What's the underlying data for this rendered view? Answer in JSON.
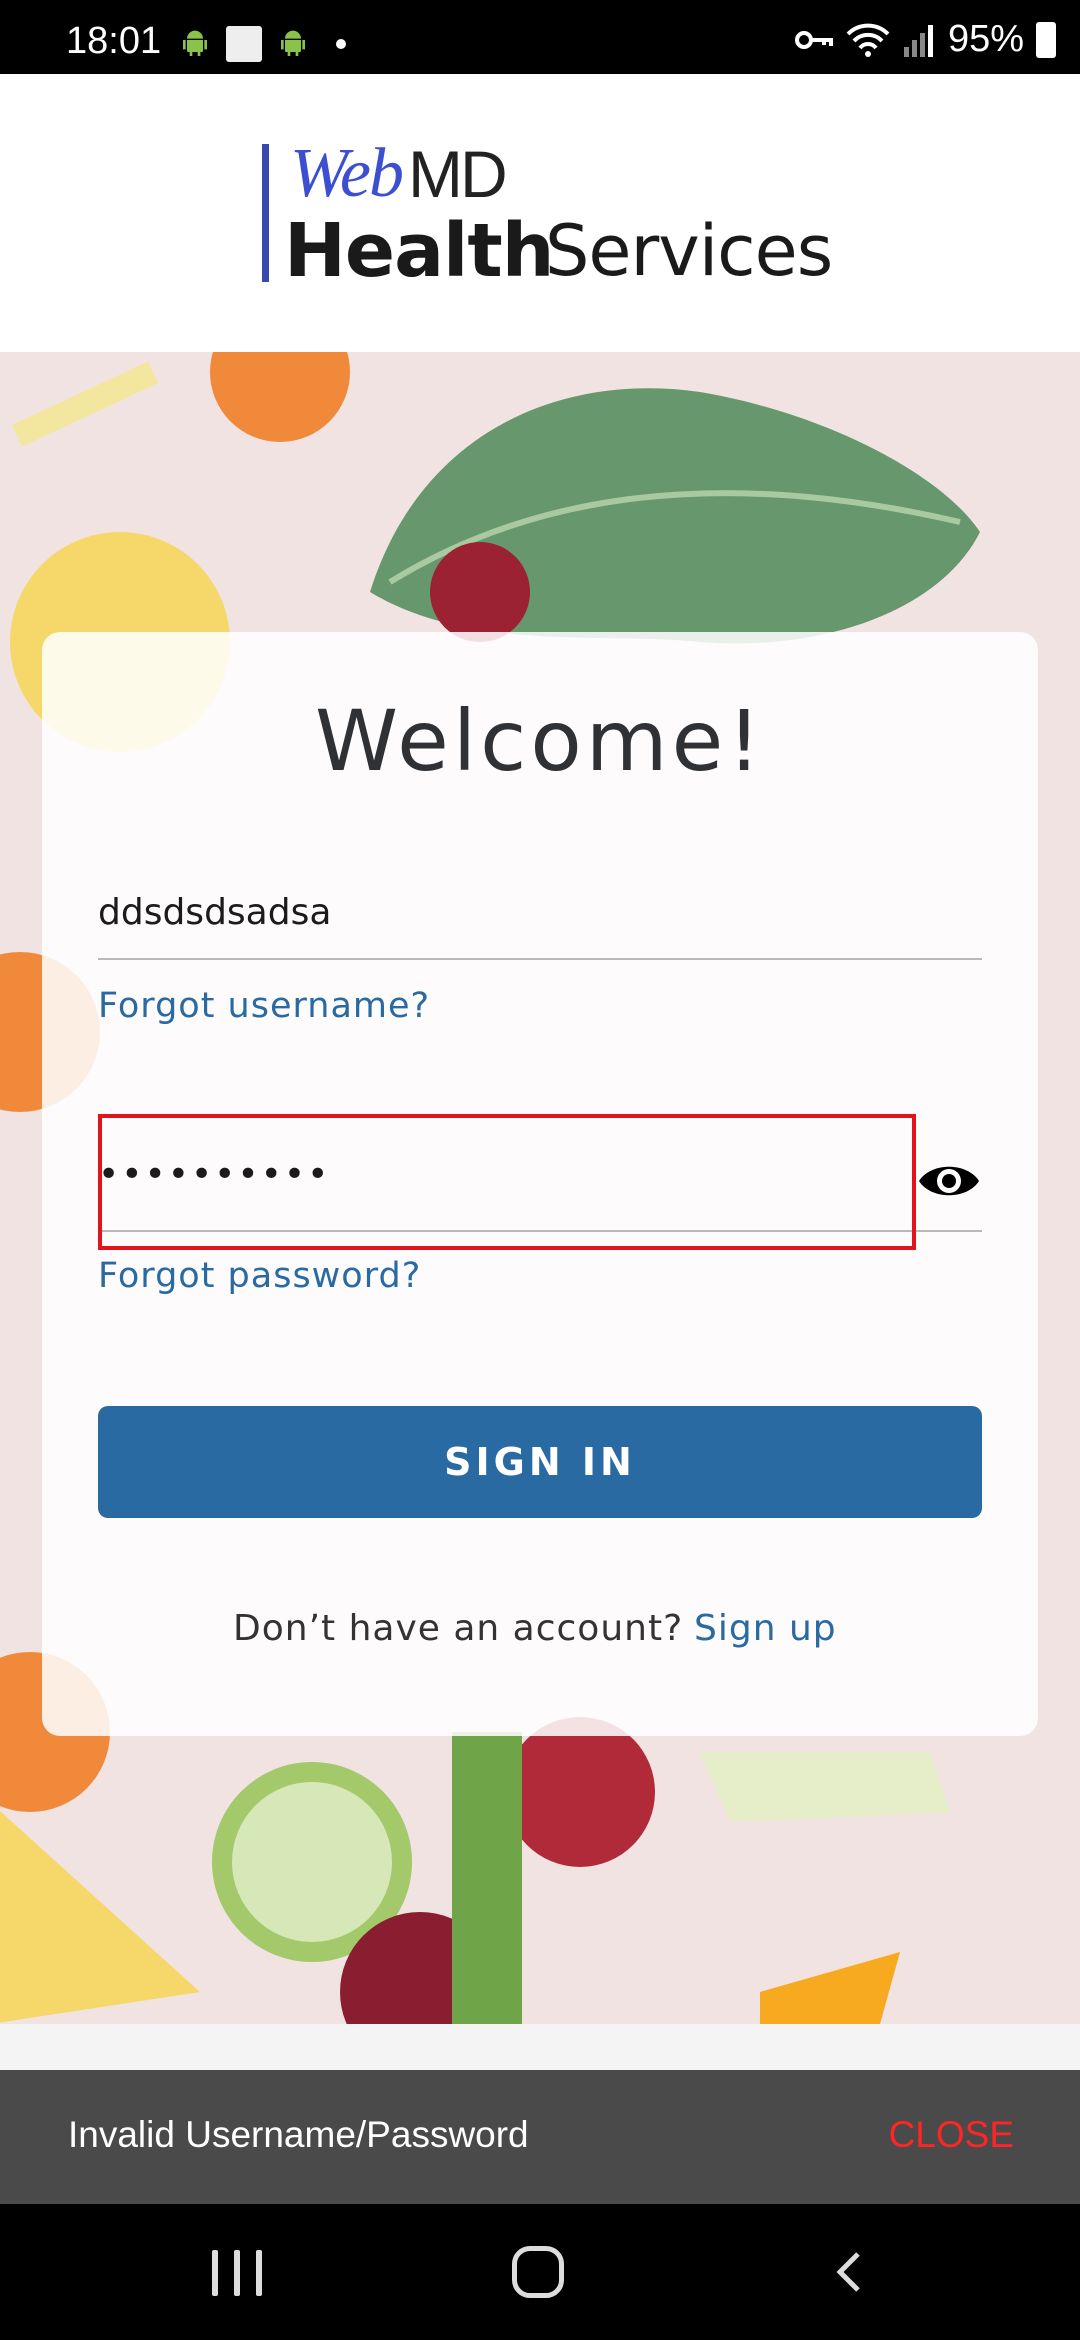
{
  "status_bar": {
    "time": "18:01",
    "battery": "95%"
  },
  "header": {
    "logo_web": "Web",
    "logo_md": "MD",
    "logo_health": "Health",
    "logo_services": "Services"
  },
  "login": {
    "title": "Welcome!",
    "username_value": "ddsdsdsadsa",
    "forgot_username": "Forgot username?",
    "password_value": "••••••••••",
    "forgot_password": "Forgot password?",
    "signin_label": "SIGN IN",
    "no_account_text": "Don’t have an account?",
    "signup_link": "Sign up"
  },
  "toast": {
    "message": "Invalid Username/Password",
    "close_label": "CLOSE"
  },
  "colors": {
    "accent": "#2a6aa3",
    "highlight": "#e0141a",
    "toast_close": "#ff2525"
  }
}
